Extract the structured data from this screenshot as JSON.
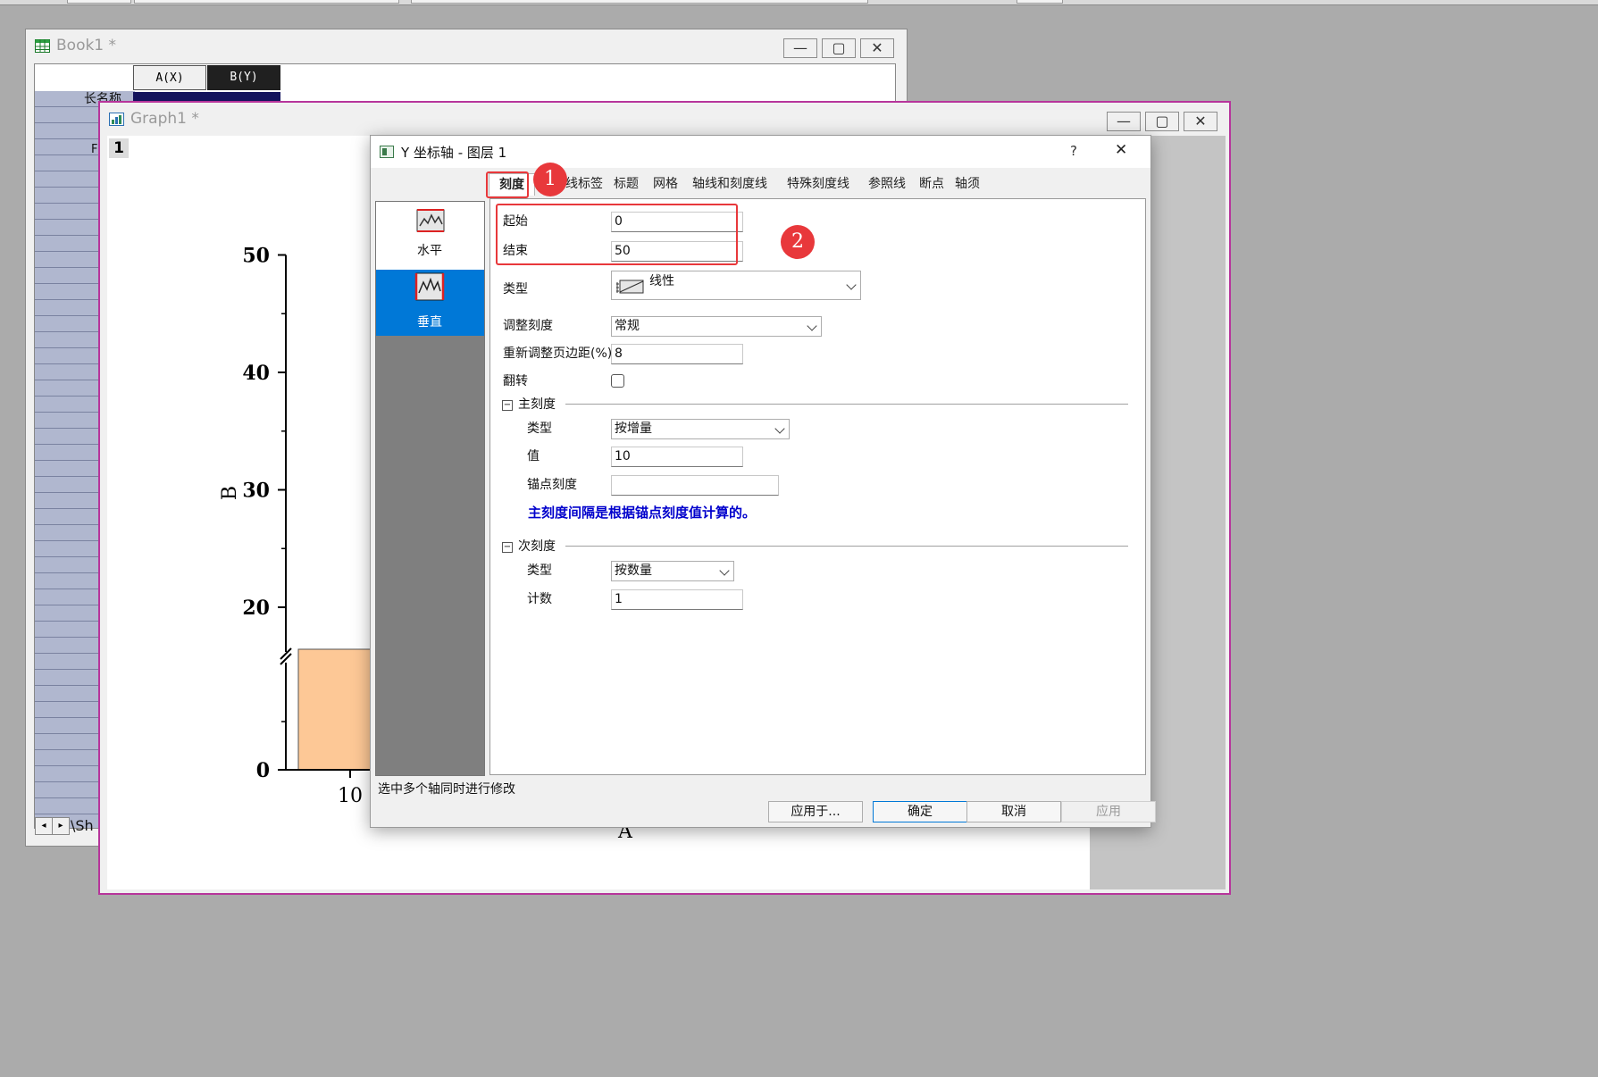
{
  "book": {
    "title": "Book1 *",
    "col_a": "A(X)",
    "col_b": "B(Y)",
    "row_long_name": "长名称",
    "row_f": "F",
    "sheet_tab": "\\Sh"
  },
  "graph": {
    "title": "Graph1 *",
    "layer_num": "1"
  },
  "chart_data": {
    "type": "bar",
    "categories": [
      "10"
    ],
    "values": [
      15
    ],
    "title": "",
    "xlabel": "A",
    "ylabel": "B",
    "yticks": [
      "0",
      "20",
      "30",
      "40",
      "50"
    ],
    "xticks": [
      "10"
    ],
    "axis_break": "between 0 and 20",
    "bar_color": "#fdc896"
  },
  "dialog": {
    "title": "Y 坐标轴 - 图层 1",
    "help": "?",
    "close": "✕",
    "tabs": [
      "刻度",
      "刻度线标签",
      "标题",
      "网格",
      "轴线和刻度线",
      "特殊刻度线",
      "参照线",
      "断点",
      "轴须"
    ],
    "left_items": [
      "水平",
      "垂直"
    ],
    "start_label": "起始",
    "start_value": "0",
    "end_label": "结束",
    "end_value": "50",
    "type_label": "类型",
    "type_value": "线性",
    "rescale_label": "调整刻度",
    "rescale_value": "常规",
    "margin_label": "重新调整页边距(%)",
    "margin_value": "8",
    "flip_label": "翻转",
    "major": {
      "header": "主刻度",
      "type_label": "类型",
      "type_value": "按增量",
      "value_label": "值",
      "value": "10",
      "anchor_label": "锚点刻度",
      "anchor_value": "",
      "note": "主刻度间隔是根据锚点刻度值计算的。"
    },
    "minor": {
      "header": "次刻度",
      "type_label": "类型",
      "type_value": "按数量",
      "count_label": "计数",
      "count_value": "1"
    },
    "status": "选中多个轴同时进行修改",
    "buttons": {
      "apply_to": "应用于...",
      "ok": "确定",
      "cancel": "取消",
      "apply": "应用"
    },
    "badges": [
      "1",
      "2"
    ]
  },
  "colors": {
    "accent": "#0078d7",
    "annotation": "#e8383b",
    "note_text": "#0000cc"
  }
}
